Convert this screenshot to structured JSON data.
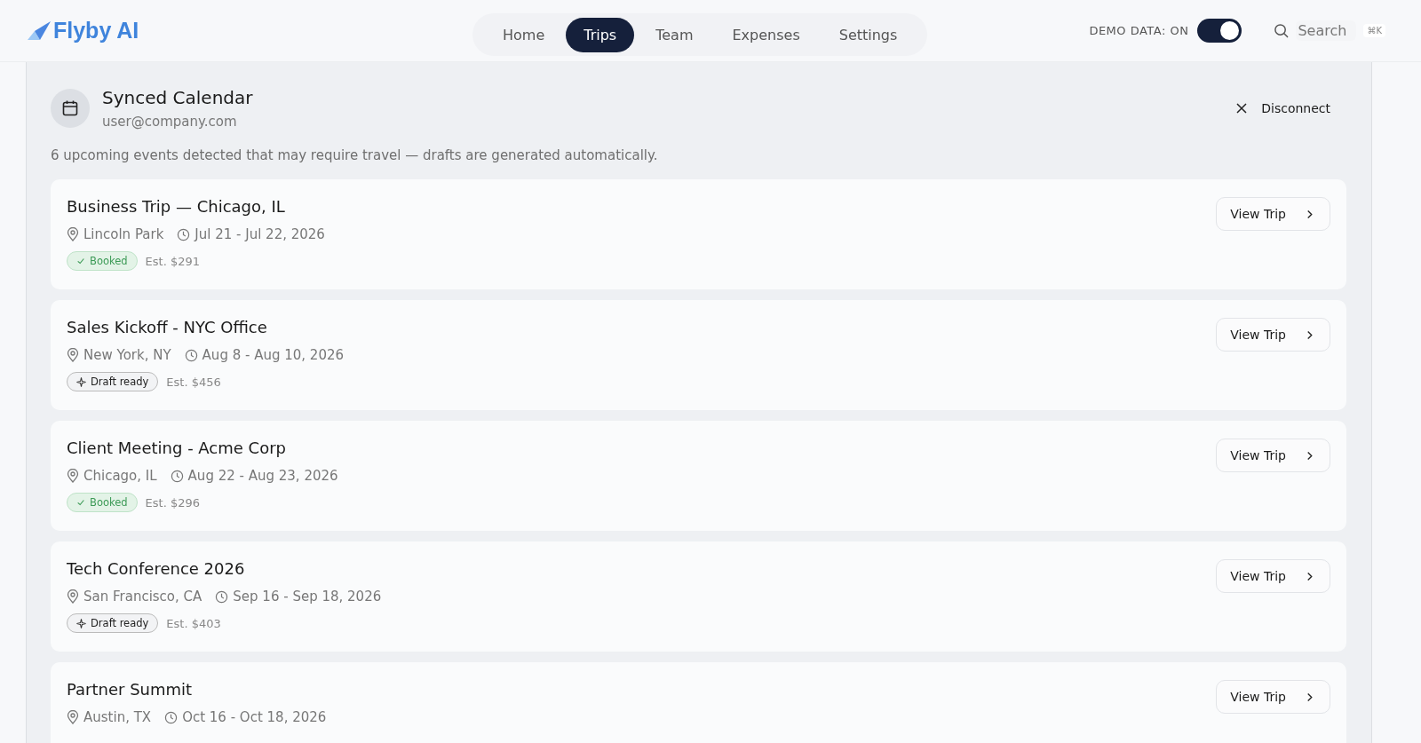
{
  "brand": {
    "name": "Flyby AI"
  },
  "nav": [
    {
      "label": "Home",
      "selected": false
    },
    {
      "label": "Trips",
      "selected": true
    },
    {
      "label": "Team",
      "selected": false
    },
    {
      "label": "Expenses",
      "selected": false
    },
    {
      "label": "Settings",
      "selected": false
    }
  ],
  "demo_toggle": {
    "label": "DEMO DATA: ON",
    "on": true
  },
  "search": {
    "placeholder": "Search",
    "shortcut": "⌘K"
  },
  "calendar": {
    "title": "Synced Calendar",
    "account": "user@company.com",
    "action": "Disconnect",
    "note": "6 upcoming events detected that may require travel — drafts are generated automatically."
  },
  "trips": [
    {
      "title": "Business Trip — Chicago, IL",
      "location": "Lincoln Park",
      "dates": "Jul 21 - Jul 22, 2026",
      "status": {
        "kind": "booked",
        "label": "Booked"
      },
      "estimate": "Est. $291",
      "button": "View Trip"
    },
    {
      "title": "Sales Kickoff - NYC Office",
      "location": "New York, NY",
      "dates": "Aug 8 - Aug 10, 2026",
      "status": {
        "kind": "draft",
        "label": "Draft ready"
      },
      "estimate": "Est. $456",
      "button": "View Trip"
    },
    {
      "title": "Client Meeting - Acme Corp",
      "location": "Chicago, IL",
      "dates": "Aug 22 - Aug 23, 2026",
      "status": {
        "kind": "booked",
        "label": "Booked"
      },
      "estimate": "Est. $296",
      "button": "View Trip"
    },
    {
      "title": "Tech Conference 2026",
      "location": "San Francisco, CA",
      "dates": "Sep 16 - Sep 18, 2026",
      "status": {
        "kind": "draft",
        "label": "Draft ready"
      },
      "estimate": "Est. $403",
      "button": "View Trip"
    },
    {
      "title": "Partner Summit",
      "location": "Austin, TX",
      "dates": "Oct 16 - Oct 18, 2026",
      "button": "View Trip"
    }
  ]
}
